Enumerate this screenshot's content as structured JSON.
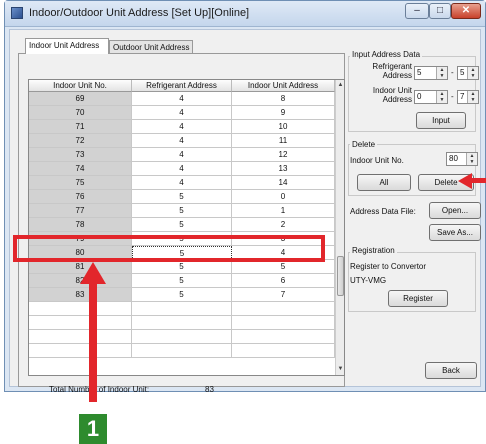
{
  "window": {
    "title": "Indoor/Outdoor Unit Address [Set Up][Online]",
    "controls": {
      "minimize": "–",
      "maximize": "□",
      "close": "✕"
    }
  },
  "tabs": [
    {
      "label": "Indoor Unit Address",
      "active": true
    },
    {
      "label": "Outdoor Unit Address",
      "active": false
    }
  ],
  "table": {
    "columns": [
      "Indoor Unit No.",
      "Refrigerant Address",
      "Indoor Unit Address"
    ],
    "rows": [
      [
        "69",
        "4",
        "8"
      ],
      [
        "70",
        "4",
        "9"
      ],
      [
        "71",
        "4",
        "10"
      ],
      [
        "72",
        "4",
        "11"
      ],
      [
        "73",
        "4",
        "12"
      ],
      [
        "74",
        "4",
        "13"
      ],
      [
        "75",
        "4",
        "14"
      ],
      [
        "76",
        "5",
        "0"
      ],
      [
        "77",
        "5",
        "1"
      ],
      [
        "78",
        "5",
        "2"
      ],
      [
        "79",
        "5",
        "3"
      ],
      [
        "80",
        "5",
        "4"
      ],
      [
        "81",
        "5",
        "5"
      ],
      [
        "82",
        "5",
        "6"
      ],
      [
        "83",
        "5",
        "7"
      ],
      [
        "",
        "",
        ""
      ],
      [
        "",
        "",
        ""
      ],
      [
        "",
        "",
        ""
      ],
      [
        "",
        "",
        ""
      ]
    ],
    "selected_row": "80"
  },
  "total": {
    "label": "Total Number of Indoor Unit:",
    "value": "83"
  },
  "input_address": {
    "title": "Input Address Data",
    "refrigerant_label": "Refrigerant Address",
    "refrigerant_from": "5",
    "refrigerant_to": "5",
    "indoor_label": "Indoor Unit Address",
    "indoor_from": "0",
    "indoor_to": "7",
    "dash": "-",
    "input_button": "Input"
  },
  "delete": {
    "title": "Delete",
    "unit_label": "Indoor Unit No.",
    "unit_value": "80",
    "all_button": "All",
    "delete_button": "Delete"
  },
  "file": {
    "label": "Address Data File:",
    "open_button": "Open...",
    "save_button": "Save As..."
  },
  "registration": {
    "title": "Registration",
    "text": "Register to Convertor",
    "model": "UTY-VMG",
    "register_button": "Register"
  },
  "back_button": "Back",
  "annotation": {
    "number": "1",
    "color": "#e2262b",
    "badge_color": "#2e8b2e"
  }
}
